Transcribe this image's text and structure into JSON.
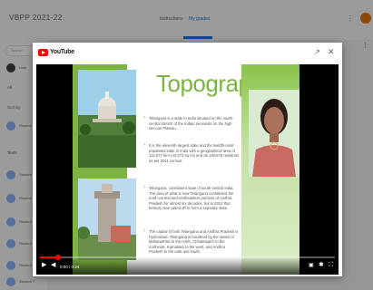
{
  "app": {
    "title": "VBPP 2021-22"
  },
  "header": {
    "tabs": [
      {
        "label": "Instructions"
      },
      {
        "label": "My grades"
      }
    ]
  },
  "sidebar": {
    "search_placeholder": "Search",
    "labels": [
      "All",
      "Sort by",
      "Tests",
      "Discussions"
    ],
    "items": [
      {
        "label": "User"
      },
      {
        "label": "Student 1"
      },
      {
        "label": "Student 2"
      },
      {
        "label": "Student 3"
      },
      {
        "label": "Student 4"
      },
      {
        "label": "Student 5"
      },
      {
        "label": "Student 6"
      },
      {
        "label": "Student 7"
      },
      {
        "label": "Student 8"
      }
    ]
  },
  "modal": {
    "brand": "YouTube"
  },
  "slide": {
    "title": "Topography",
    "bullets": [
      "Telangana is a state in India situated on the south-central stretch of the Indian peninsula on the high Deccan Plateau.",
      "It is the eleventh-largest state and the twelfth-most populated state in India with a geographical area of 112,077 km² (43,273 sq mi) and 35,193,978 residents as per 2011 census.",
      "Telangana, constituent state of south-central India. The area of what is now Telangana constituted the north-central and northeastern portions of Andhra Pradesh for almost six decades, but in 2014 that territory was called off to form a separate state.",
      "The capital of both Telangana and Andhra Pradesh is Hyderabad. Telangana is bordered by the states of Maharashtra to the north, Chhattisgarh to the northeast, Karnataka to the west, and Andhra Pradesh to the east and south."
    ]
  },
  "player": {
    "time": "0:00 / 0:24",
    "progress_fraction": 0.06
  },
  "colors": {
    "accent": "#1a73e8",
    "slide_green": "#7cb342",
    "youtube_red": "#ff0000"
  },
  "icons": [
    "youtube-logo-icon",
    "external-link-icon",
    "close-icon",
    "play-icon",
    "volume-icon",
    "captions-icon",
    "settings-icon",
    "fullscreen-icon",
    "more-vert-icon"
  ]
}
